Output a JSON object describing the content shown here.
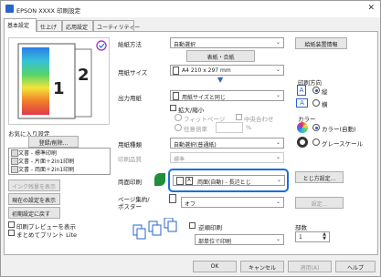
{
  "window": {
    "title": "EPSON XXXX 印刷設定",
    "close": "✕"
  },
  "tabs": [
    "基本設定",
    "仕上げ",
    "応用設定",
    "ユーティリティー"
  ],
  "preview": {
    "page_numbers": [
      "1",
      "2"
    ]
  },
  "fields": {
    "paper_source": {
      "label": "給紙方法",
      "value": "自動選択"
    },
    "paper_source_button": "表紙・合紙",
    "paper_size": {
      "label": "用紙サイズ",
      "value": "A4 210 x 297 mm"
    },
    "output_paper": {
      "label": "出力用紙",
      "value": "用紙サイズと同じ"
    },
    "scale": {
      "label": "拡大/縮小",
      "fit_page": "フィットページ",
      "center": "中央合わせ",
      "any_scale": "任意倍率",
      "percent": "%"
    },
    "paper_type": {
      "label": "用紙種類",
      "value": "自動選択(普通紙)"
    },
    "quality": {
      "label": "印刷品質",
      "value": "標準"
    },
    "duplex": {
      "label": "両面印刷",
      "value": "両面(自動) - 長辺とじ",
      "button": "とじ方設定..."
    },
    "multipage": {
      "label": "ページ集約/\nポスター",
      "value": "オフ",
      "button": "設定..."
    },
    "reverse": {
      "label": "逆順印刷"
    },
    "collate": {
      "value": "部単位で印刷"
    },
    "copies": {
      "label": "部数",
      "value": "1"
    }
  },
  "right": {
    "paper_info_button": "給紙装置情報",
    "orientation": {
      "label": "印刷方向",
      "options": [
        "縦",
        "横"
      ],
      "selected": "縦"
    },
    "color": {
      "label": "カラー",
      "options": [
        "カラー(自動)",
        "グレースケール"
      ],
      "selected": "カラー(自動)"
    }
  },
  "favorites": {
    "label": "お気に入り設定",
    "button": "登録/削除...",
    "items": [
      "文書 - 標準印刷",
      "文書 - 片面＋2in1印刷",
      "文書 - 両面＋2in1印刷"
    ]
  },
  "left_buttons": {
    "ink": "インク残量を表示",
    "show_settings": "現在の設定を表示",
    "reset": "初期設定に戻す"
  },
  "left_checks": {
    "preview": "印刷プレビューを表示",
    "lite": "まとめてプリント Lite"
  },
  "footer": {
    "ok": "OK",
    "cancel": "キャンセル",
    "apply": "適用(A)",
    "help": "ヘルプ"
  },
  "colors": {
    "accent": "#1a6fd8",
    "window_bg": "#f0f0f0",
    "green_icon": "#1f8f3a"
  }
}
